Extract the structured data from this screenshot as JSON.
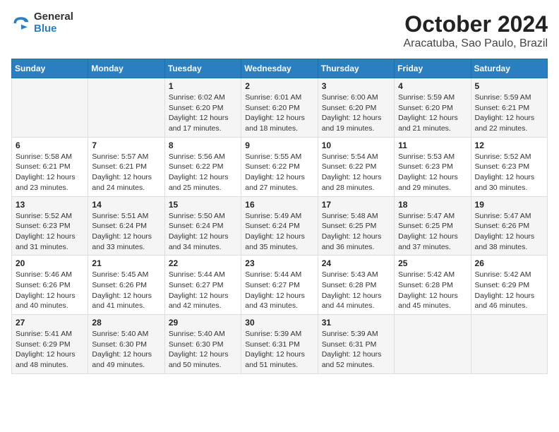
{
  "header": {
    "logo": {
      "line1": "General",
      "line2": "Blue"
    },
    "title": "October 2024",
    "subtitle": "Aracatuba, Sao Paulo, Brazil"
  },
  "calendar": {
    "headers": [
      "Sunday",
      "Monday",
      "Tuesday",
      "Wednesday",
      "Thursday",
      "Friday",
      "Saturday"
    ],
    "rows": [
      [
        {
          "day": "",
          "sunrise": "",
          "sunset": "",
          "daylight": ""
        },
        {
          "day": "",
          "sunrise": "",
          "sunset": "",
          "daylight": ""
        },
        {
          "day": "1",
          "sunrise": "Sunrise: 6:02 AM",
          "sunset": "Sunset: 6:20 PM",
          "daylight": "Daylight: 12 hours and 17 minutes."
        },
        {
          "day": "2",
          "sunrise": "Sunrise: 6:01 AM",
          "sunset": "Sunset: 6:20 PM",
          "daylight": "Daylight: 12 hours and 18 minutes."
        },
        {
          "day": "3",
          "sunrise": "Sunrise: 6:00 AM",
          "sunset": "Sunset: 6:20 PM",
          "daylight": "Daylight: 12 hours and 19 minutes."
        },
        {
          "day": "4",
          "sunrise": "Sunrise: 5:59 AM",
          "sunset": "Sunset: 6:20 PM",
          "daylight": "Daylight: 12 hours and 21 minutes."
        },
        {
          "day": "5",
          "sunrise": "Sunrise: 5:59 AM",
          "sunset": "Sunset: 6:21 PM",
          "daylight": "Daylight: 12 hours and 22 minutes."
        }
      ],
      [
        {
          "day": "6",
          "sunrise": "Sunrise: 5:58 AM",
          "sunset": "Sunset: 6:21 PM",
          "daylight": "Daylight: 12 hours and 23 minutes."
        },
        {
          "day": "7",
          "sunrise": "Sunrise: 5:57 AM",
          "sunset": "Sunset: 6:21 PM",
          "daylight": "Daylight: 12 hours and 24 minutes."
        },
        {
          "day": "8",
          "sunrise": "Sunrise: 5:56 AM",
          "sunset": "Sunset: 6:22 PM",
          "daylight": "Daylight: 12 hours and 25 minutes."
        },
        {
          "day": "9",
          "sunrise": "Sunrise: 5:55 AM",
          "sunset": "Sunset: 6:22 PM",
          "daylight": "Daylight: 12 hours and 27 minutes."
        },
        {
          "day": "10",
          "sunrise": "Sunrise: 5:54 AM",
          "sunset": "Sunset: 6:22 PM",
          "daylight": "Daylight: 12 hours and 28 minutes."
        },
        {
          "day": "11",
          "sunrise": "Sunrise: 5:53 AM",
          "sunset": "Sunset: 6:23 PM",
          "daylight": "Daylight: 12 hours and 29 minutes."
        },
        {
          "day": "12",
          "sunrise": "Sunrise: 5:52 AM",
          "sunset": "Sunset: 6:23 PM",
          "daylight": "Daylight: 12 hours and 30 minutes."
        }
      ],
      [
        {
          "day": "13",
          "sunrise": "Sunrise: 5:52 AM",
          "sunset": "Sunset: 6:23 PM",
          "daylight": "Daylight: 12 hours and 31 minutes."
        },
        {
          "day": "14",
          "sunrise": "Sunrise: 5:51 AM",
          "sunset": "Sunset: 6:24 PM",
          "daylight": "Daylight: 12 hours and 33 minutes."
        },
        {
          "day": "15",
          "sunrise": "Sunrise: 5:50 AM",
          "sunset": "Sunset: 6:24 PM",
          "daylight": "Daylight: 12 hours and 34 minutes."
        },
        {
          "day": "16",
          "sunrise": "Sunrise: 5:49 AM",
          "sunset": "Sunset: 6:24 PM",
          "daylight": "Daylight: 12 hours and 35 minutes."
        },
        {
          "day": "17",
          "sunrise": "Sunrise: 5:48 AM",
          "sunset": "Sunset: 6:25 PM",
          "daylight": "Daylight: 12 hours and 36 minutes."
        },
        {
          "day": "18",
          "sunrise": "Sunrise: 5:47 AM",
          "sunset": "Sunset: 6:25 PM",
          "daylight": "Daylight: 12 hours and 37 minutes."
        },
        {
          "day": "19",
          "sunrise": "Sunrise: 5:47 AM",
          "sunset": "Sunset: 6:26 PM",
          "daylight": "Daylight: 12 hours and 38 minutes."
        }
      ],
      [
        {
          "day": "20",
          "sunrise": "Sunrise: 5:46 AM",
          "sunset": "Sunset: 6:26 PM",
          "daylight": "Daylight: 12 hours and 40 minutes."
        },
        {
          "day": "21",
          "sunrise": "Sunrise: 5:45 AM",
          "sunset": "Sunset: 6:26 PM",
          "daylight": "Daylight: 12 hours and 41 minutes."
        },
        {
          "day": "22",
          "sunrise": "Sunrise: 5:44 AM",
          "sunset": "Sunset: 6:27 PM",
          "daylight": "Daylight: 12 hours and 42 minutes."
        },
        {
          "day": "23",
          "sunrise": "Sunrise: 5:44 AM",
          "sunset": "Sunset: 6:27 PM",
          "daylight": "Daylight: 12 hours and 43 minutes."
        },
        {
          "day": "24",
          "sunrise": "Sunrise: 5:43 AM",
          "sunset": "Sunset: 6:28 PM",
          "daylight": "Daylight: 12 hours and 44 minutes."
        },
        {
          "day": "25",
          "sunrise": "Sunrise: 5:42 AM",
          "sunset": "Sunset: 6:28 PM",
          "daylight": "Daylight: 12 hours and 45 minutes."
        },
        {
          "day": "26",
          "sunrise": "Sunrise: 5:42 AM",
          "sunset": "Sunset: 6:29 PM",
          "daylight": "Daylight: 12 hours and 46 minutes."
        }
      ],
      [
        {
          "day": "27",
          "sunrise": "Sunrise: 5:41 AM",
          "sunset": "Sunset: 6:29 PM",
          "daylight": "Daylight: 12 hours and 48 minutes."
        },
        {
          "day": "28",
          "sunrise": "Sunrise: 5:40 AM",
          "sunset": "Sunset: 6:30 PM",
          "daylight": "Daylight: 12 hours and 49 minutes."
        },
        {
          "day": "29",
          "sunrise": "Sunrise: 5:40 AM",
          "sunset": "Sunset: 6:30 PM",
          "daylight": "Daylight: 12 hours and 50 minutes."
        },
        {
          "day": "30",
          "sunrise": "Sunrise: 5:39 AM",
          "sunset": "Sunset: 6:31 PM",
          "daylight": "Daylight: 12 hours and 51 minutes."
        },
        {
          "day": "31",
          "sunrise": "Sunrise: 5:39 AM",
          "sunset": "Sunset: 6:31 PM",
          "daylight": "Daylight: 12 hours and 52 minutes."
        },
        {
          "day": "",
          "sunrise": "",
          "sunset": "",
          "daylight": ""
        },
        {
          "day": "",
          "sunrise": "",
          "sunset": "",
          "daylight": ""
        }
      ]
    ]
  }
}
